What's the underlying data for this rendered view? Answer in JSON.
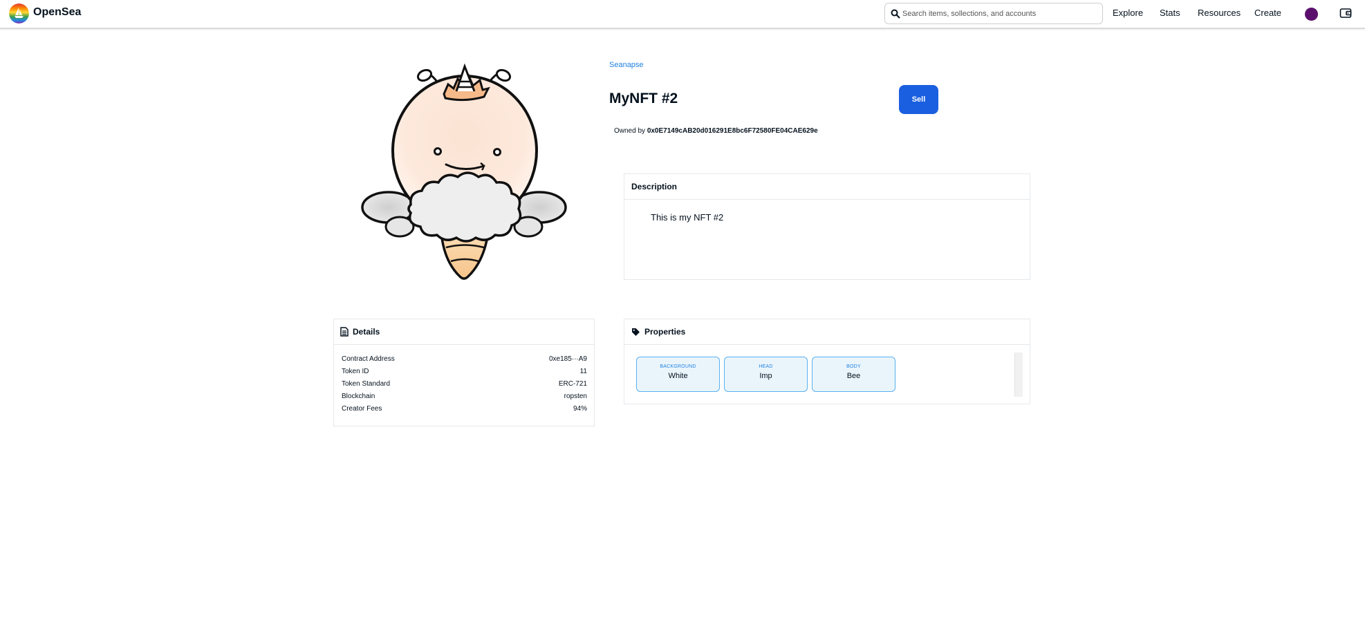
{
  "header": {
    "brand": "OpenSea",
    "search_placeholder": "Search items, sollections, and accounts",
    "nav": [
      "Explore",
      "Stats",
      "Resources",
      "Create"
    ]
  },
  "nft": {
    "collection": "Seanapse",
    "title": "MyNFT #2",
    "sell_label": "Sell",
    "owned_prefix": "Owned by",
    "owner": "0x0E7149cAB20d016291E8bc6F72580FE04CAE629e"
  },
  "description": {
    "title": "Description",
    "text": "This is my NFT #2"
  },
  "details": {
    "title": "Details",
    "rows": [
      {
        "label": "Contract Address",
        "value": "0xe185···A9"
      },
      {
        "label": "Token ID",
        "value": "11"
      },
      {
        "label": "Token Standard",
        "value": "ERC-721"
      },
      {
        "label": "Blockchain",
        "value": "ropsten"
      },
      {
        "label": "Creator Fees",
        "value": "94%"
      }
    ]
  },
  "properties": {
    "title": "Properties",
    "items": [
      {
        "type": "BACKGROUND",
        "value": "White"
      },
      {
        "type": "HEAD",
        "value": "Imp"
      },
      {
        "type": "BODY",
        "value": "Bee"
      }
    ]
  },
  "colors": {
    "accent": "#2081e2",
    "sell_button": "#1a5fe0",
    "avatar": "#5b0f6d"
  }
}
